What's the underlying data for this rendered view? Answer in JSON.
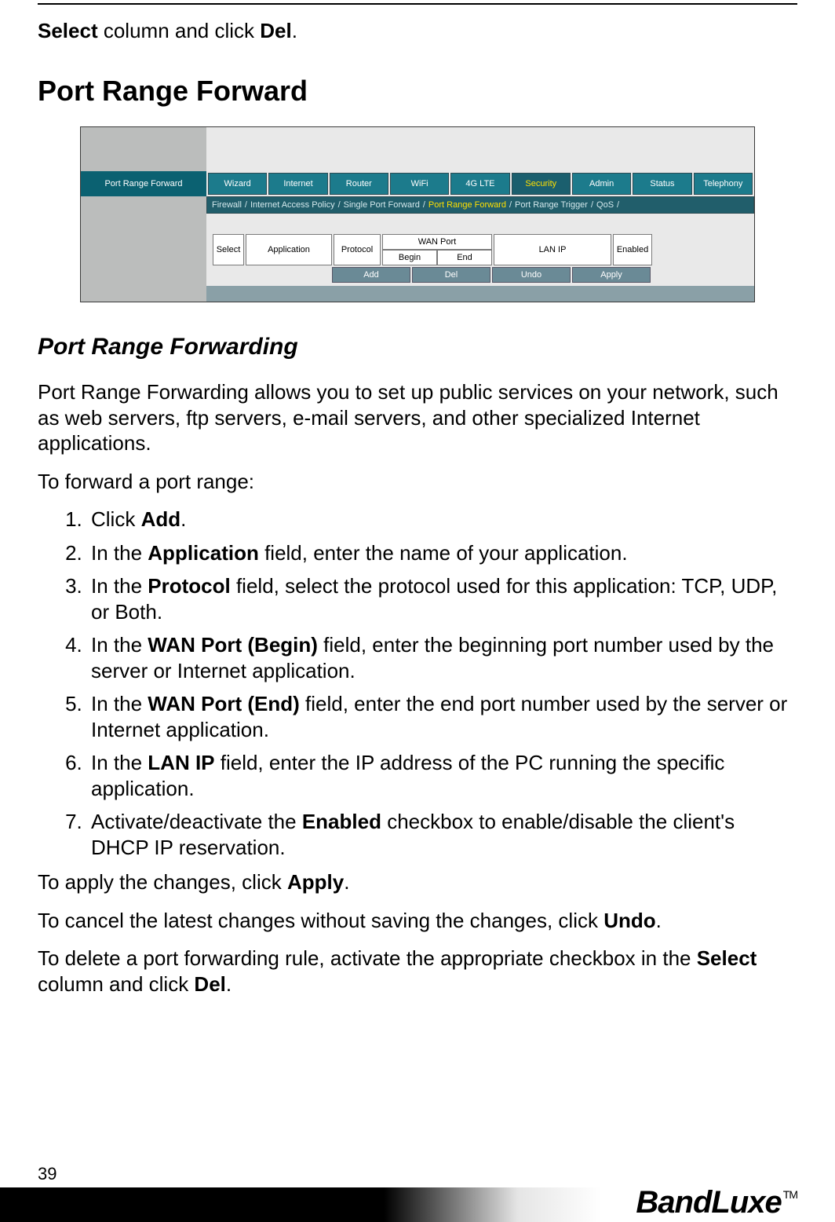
{
  "intro": {
    "bold1": "Select",
    "mid": " column and click ",
    "bold2": "Del",
    "tail": "."
  },
  "h1": "Port Range Forward",
  "ui": {
    "side_label": "Port Range Forward",
    "tabs": [
      "Wizard",
      "Internet",
      "Router",
      "WiFi",
      "4G LTE",
      "Security",
      "Admin",
      "Status",
      "Telephony"
    ],
    "active_tab_index": 5,
    "subtabs": {
      "items": [
        "Firewall",
        "Internet Access Policy",
        "Single Port Forward",
        "Port Range Forward",
        "Port Range Trigger",
        "QoS"
      ],
      "active_index": 3,
      "sep": " / "
    },
    "cols": {
      "select": "Select",
      "application": "Application",
      "protocol": "Protocol",
      "wan_port": "WAN Port",
      "begin": "Begin",
      "end": "End",
      "lan_ip": "LAN IP",
      "enabled": "Enabled"
    },
    "buttons": {
      "add": "Add",
      "del": "Del",
      "undo": "Undo",
      "apply": "Apply"
    }
  },
  "h2": "Port Range Forwarding",
  "p1": "Port Range Forwarding allows you to set up public services on your network, such as web servers, ftp servers, e-mail servers, and other specialized Internet applications.",
  "p2": "To forward a port range:",
  "steps": [
    {
      "pre": "Click ",
      "b": "Add",
      "post": "."
    },
    {
      "pre": "In the ",
      "b": "Application",
      "post": " field, enter the name of your application."
    },
    {
      "pre": "In the ",
      "b": "Protocol",
      "post": " field, select the protocol used for this application: TCP, UDP, or Both."
    },
    {
      "pre": "In the ",
      "b": "WAN Port (Begin)",
      "post": " field, enter the beginning port number used by the server or Internet application."
    },
    {
      "pre": "In the ",
      "b": "WAN Port (End)",
      "post": " field, enter the end port number used by the server or Internet application."
    },
    {
      "pre": "In the ",
      "b": "LAN IP",
      "post": " field, enter the IP address of the PC running the specific application."
    },
    {
      "pre": "Activate/deactivate the ",
      "b": "Enabled",
      "post": " checkbox to enable/disable the client's DHCP IP reservation."
    }
  ],
  "p3": {
    "pre": "To apply the changes, click ",
    "b": "Apply",
    "post": "."
  },
  "p4": {
    "pre": "To cancel the latest changes without saving the changes, click ",
    "b": "Undo",
    "post": "."
  },
  "p5": {
    "pre": "To delete a port forwarding rule, activate the appropriate checkbox in the ",
    "b1": "Select",
    "mid": " column and click ",
    "b2": "Del",
    "post": "."
  },
  "page_number": "39",
  "brand": "BandLuxe",
  "tm": "TM"
}
